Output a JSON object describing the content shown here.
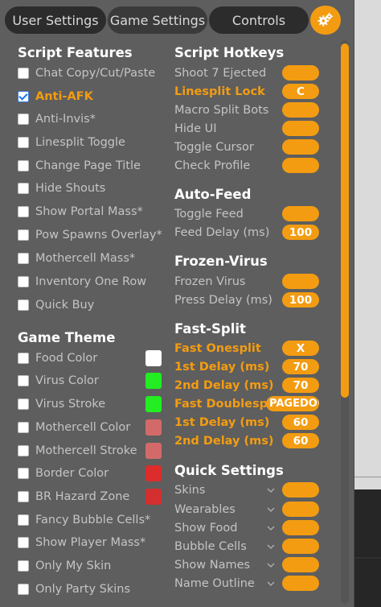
{
  "tabs": {
    "user": "User Settings",
    "game": "Game Settings",
    "controls": "Controls",
    "settings_icon": "gears-icon"
  },
  "colors": {
    "accent": "#f39c12",
    "panel": "#5e5e5e",
    "tab": "#2c2c2c"
  },
  "features": {
    "title": "Script Features",
    "items": [
      {
        "label": "Chat Copy/Cut/Paste",
        "checked": false
      },
      {
        "label": "Anti-AFK",
        "checked": true
      },
      {
        "label": "Anti-Invis*",
        "checked": false
      },
      {
        "label": "Linesplit Toggle",
        "checked": false
      },
      {
        "label": "Change Page Title",
        "checked": false
      },
      {
        "label": "Hide Shouts",
        "checked": false
      },
      {
        "label": "Show Portal Mass*",
        "checked": false
      },
      {
        "label": "Pow Spawns Overlay*",
        "checked": false
      },
      {
        "label": "Mothercell Mass*",
        "checked": false
      },
      {
        "label": "Inventory One Row",
        "checked": false
      },
      {
        "label": "Quick Buy",
        "checked": false
      }
    ]
  },
  "theme": {
    "title": "Game Theme",
    "items": [
      {
        "label": "Food Color",
        "checked": false,
        "color": "#ffffff"
      },
      {
        "label": "Virus Color",
        "checked": false,
        "color": "#22ee22"
      },
      {
        "label": "Virus Stroke",
        "checked": false,
        "color": "#22ee22"
      },
      {
        "label": "Mothercell Color",
        "checked": false,
        "color": "#d36a6a"
      },
      {
        "label": "Mothercell Stroke",
        "checked": false,
        "color": "#d36a6a"
      },
      {
        "label": "Border Color",
        "checked": false,
        "color": "#dd2c2c"
      },
      {
        "label": "BR Hazard Zone",
        "checked": false,
        "color": "#d32f2f"
      },
      {
        "label": "Fancy Bubble Cells*",
        "checked": false
      },
      {
        "label": "Show Player Mass*",
        "checked": false
      },
      {
        "label": "Only My Skin",
        "checked": false
      },
      {
        "label": "Only Party Skins",
        "checked": false
      }
    ]
  },
  "hotkeys": {
    "title": "Script Hotkeys",
    "items": [
      {
        "label": "Shoot 7 Ejected",
        "value": "",
        "active": false
      },
      {
        "label": "Linesplit Lock",
        "value": "C",
        "active": true
      },
      {
        "label": "Macro Split Bots",
        "value": "",
        "active": false
      },
      {
        "label": "Hide UI",
        "value": "",
        "active": false
      },
      {
        "label": "Toggle Cursor",
        "value": "",
        "active": false
      },
      {
        "label": "Check Profile",
        "value": "",
        "active": false
      }
    ]
  },
  "autofeed": {
    "title": "Auto-Feed",
    "items": [
      {
        "label": "Toggle Feed",
        "value": "",
        "active": false
      },
      {
        "label": "Feed Delay (ms)",
        "value": "100",
        "active": false
      }
    ]
  },
  "frozen": {
    "title": "Frozen-Virus",
    "items": [
      {
        "label": "Frozen Virus",
        "value": "",
        "active": false
      },
      {
        "label": "Press Delay (ms)",
        "value": "100",
        "active": false
      }
    ]
  },
  "fastsplit": {
    "title": "Fast-Split",
    "items": [
      {
        "label": "Fast Onesplit",
        "value": "X",
        "active": true
      },
      {
        "label": "1st Delay (ms)",
        "value": "70",
        "active": true
      },
      {
        "label": "2nd Delay (ms)",
        "value": "70",
        "active": true
      },
      {
        "label": "Fast Doublesplit",
        "value": "PAGEDOWN",
        "active": true
      },
      {
        "label": "1st Delay (ms)",
        "value": "60",
        "active": true
      },
      {
        "label": "2nd Delay (ms)",
        "value": "60",
        "active": true
      }
    ]
  },
  "quick": {
    "title": "Quick Settings",
    "items": [
      {
        "label": "Skins",
        "value": ""
      },
      {
        "label": "Wearables",
        "value": ""
      },
      {
        "label": "Show Food",
        "value": ""
      },
      {
        "label": "Bubble Cells",
        "value": ""
      },
      {
        "label": "Show Names",
        "value": ""
      },
      {
        "label": "Name Outline",
        "value": ""
      }
    ]
  }
}
